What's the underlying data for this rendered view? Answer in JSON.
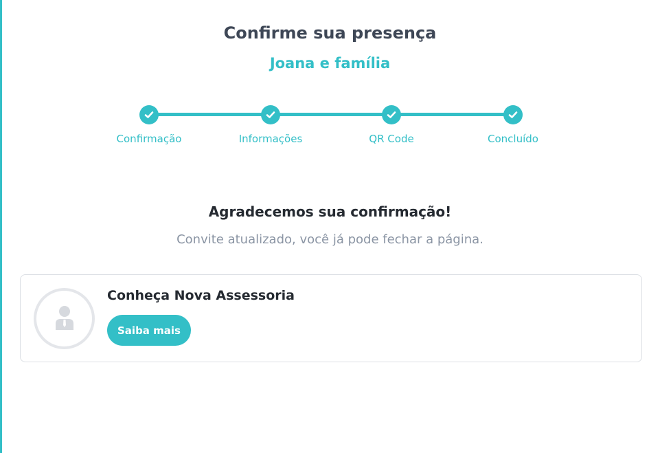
{
  "header": {
    "title": "Confirme sua presença",
    "guest_name": "Joana e família"
  },
  "steps": [
    {
      "label": "Confirmação",
      "icon": "check-icon",
      "completed": true
    },
    {
      "label": "Informações",
      "icon": "check-icon",
      "completed": true
    },
    {
      "label": "QR Code",
      "icon": "check-icon",
      "completed": true
    },
    {
      "label": "Concluído",
      "icon": "check-icon",
      "completed": true
    }
  ],
  "confirmation": {
    "heading": "Agradecemos sua confirmação!",
    "message": "Convite atualizado, você já pode fechar a página."
  },
  "promo_card": {
    "title": "Conheça Nova Assessoria",
    "button_label": "Saiba mais",
    "avatar_icon": "user-placeholder-icon"
  },
  "colors": {
    "accent": "#33bfc7",
    "title_text": "#3e4756",
    "muted_text": "#8b95a4"
  }
}
